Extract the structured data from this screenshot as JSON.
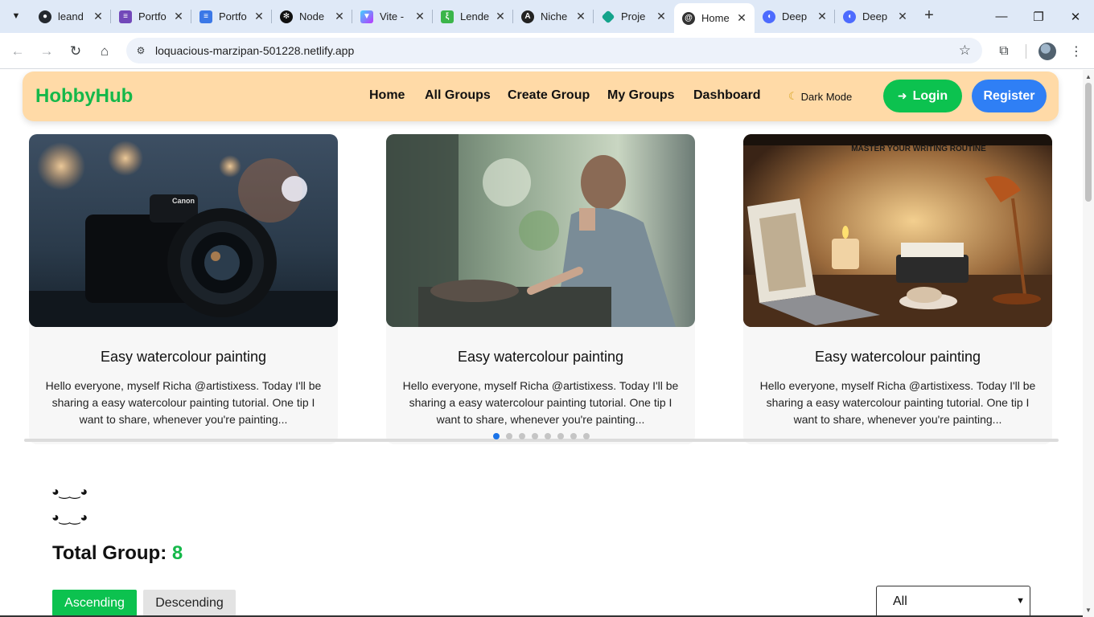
{
  "browser": {
    "tabs": [
      {
        "title": "leand",
        "favicon": "github-icon",
        "color": "#24292f"
      },
      {
        "title": "Portfo",
        "favicon": "forms-icon",
        "color": "#7248b9"
      },
      {
        "title": "Portfo",
        "favicon": "docs-icon",
        "color": "#3b78e7"
      },
      {
        "title": "Node",
        "favicon": "openai-icon",
        "color": "#111111"
      },
      {
        "title": "Vite -",
        "favicon": "vite-icon",
        "color": "#9c6cff"
      },
      {
        "title": "Lende",
        "favicon": "lendsqr-icon",
        "color": "#3bb54a"
      },
      {
        "title": "Niche",
        "favicon": "niche-icon",
        "color": "#222222"
      },
      {
        "title": "Proje",
        "favicon": "diamond-icon",
        "color": "#14a38b"
      },
      {
        "title": "Home",
        "favicon": "site-icon",
        "color": "#333333"
      },
      {
        "title": "Deep",
        "favicon": "deepseek-icon",
        "color": "#4d6bfe"
      },
      {
        "title": "Deep",
        "favicon": "deepseek-icon",
        "color": "#4d6bfe"
      }
    ],
    "active_tab_index": 8,
    "url": "loquacious-marzipan-501228.netlify.app"
  },
  "navbar": {
    "brand": "HobbyHub",
    "links": [
      "Home",
      "All Groups",
      "Create Group",
      "My Groups",
      "Dashboard"
    ],
    "dark_mode_label": "Dark Mode",
    "login_label": "Login",
    "register_label": "Register"
  },
  "carousel": {
    "cards": [
      {
        "title": "Easy watercolour painting",
        "description": "Hello everyone, myself Richa @artistixess. Today I'll be sharing a easy watercolour painting tutorial. One tip I want to share, whenever you're painting...",
        "image": "camera-photo"
      },
      {
        "title": "Easy watercolour painting",
        "description": "Hello everyone, myself Richa @artistixess. Today I'll be sharing a easy watercolour painting tutorial. One tip I want to share, whenever you're painting...",
        "image": "cooking-photo"
      },
      {
        "title": "Easy watercolour painting",
        "description": "Hello everyone, myself Richa @artistixess. Today I'll be sharing a easy watercolour painting tutorial. One tip I want to share, whenever you're painting...",
        "image": "writing-desk-photo",
        "image_caption": "MASTER YOUR WRITING ROUTINE"
      }
    ],
    "dot_count": 8,
    "active_dot": 0
  },
  "emotes": [
    "◕‿‿◕",
    "◕‿‿◕"
  ],
  "total_group": {
    "label": "Total Group:",
    "count": "8"
  },
  "sort": {
    "ascending_label": "Ascending",
    "descending_label": "Descending"
  },
  "filter": {
    "selected": "All"
  },
  "colors": {
    "brand": "#15b84a",
    "login": "#0cc24f",
    "register": "#2f7ff5",
    "navbar": "#ffdaa7"
  }
}
